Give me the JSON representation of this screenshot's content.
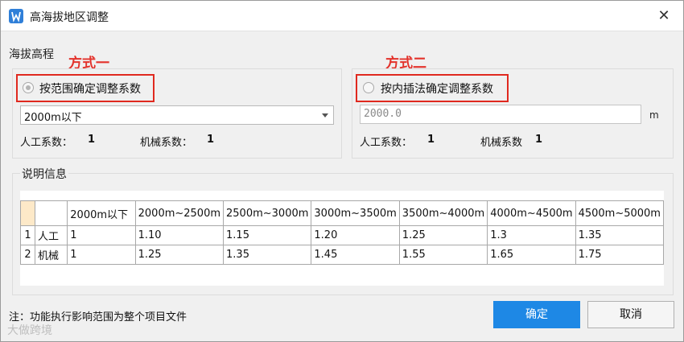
{
  "window": {
    "title": "高海拔地区调整",
    "close_glyph": "✕"
  },
  "altitude_section_label": "海拔高程",
  "method_one": {
    "annotation": "方式一",
    "radio_label": "按范围确定调整系数",
    "selected": true,
    "dropdown_value": "2000m以下",
    "labor_label": "人工系数：",
    "labor_value": "1",
    "machine_label": "机械系数：",
    "machine_value": "1"
  },
  "method_two": {
    "annotation": "方式二",
    "radio_label": "按内插法确定调整系数",
    "selected": false,
    "input_value": "2000.0",
    "unit": "m",
    "labor_label": "人工系数：",
    "labor_value": "1",
    "machine_label": "机械系数",
    "machine_value": "1"
  },
  "info_section_label": "说明信息",
  "table": {
    "headers": [
      "2000m以下",
      "2000m~2500m",
      "2500m~3000m",
      "3000m~3500m",
      "3500m~4000m",
      "4000m~4500m",
      "4500m~5000m"
    ],
    "rows": [
      {
        "num": "1",
        "name": "人工",
        "values": [
          "1",
          "1.10",
          "1.15",
          "1.20",
          "1.25",
          "1.3",
          "1.35"
        ]
      },
      {
        "num": "2",
        "name": "机械",
        "values": [
          "1",
          "1.25",
          "1.35",
          "1.45",
          "1.55",
          "1.65",
          "1.75"
        ]
      }
    ]
  },
  "footer": {
    "note": "注：功能执行影响范围为整个项目文件",
    "ok_label": "确定",
    "cancel_label": "取消"
  },
  "watermark": "大做跨境",
  "colors": {
    "accent": "#1e88e5",
    "annotation_red": "#e3322b"
  }
}
